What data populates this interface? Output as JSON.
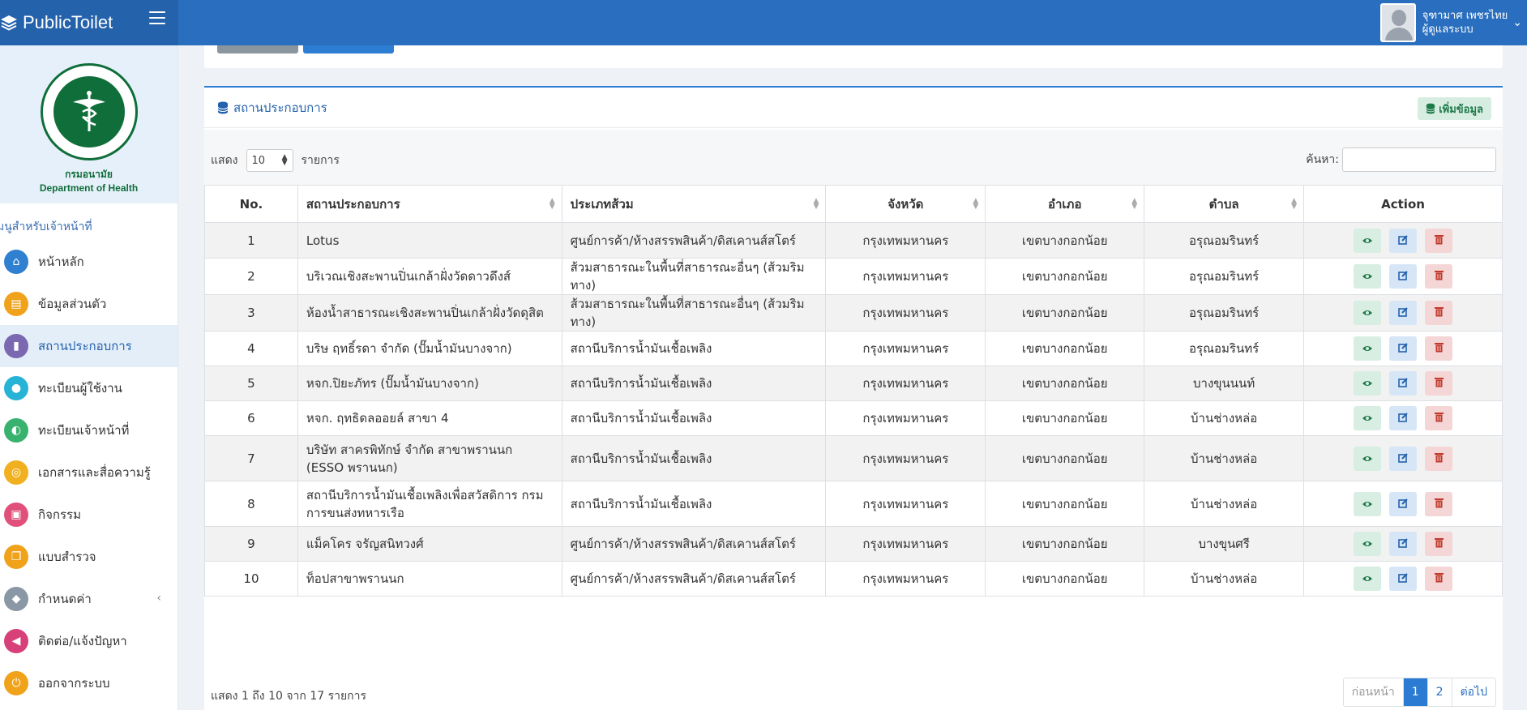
{
  "app": {
    "title": "PublicToilet"
  },
  "user": {
    "name": "จุฑามาศ เพชรไทย",
    "role": "ผู้ดูแลระบบ"
  },
  "sidebar": {
    "dept_line1": "กรมอนามัย",
    "dept_line2": "Department of Health",
    "heading": "มนูสำหรับเจ้าหน้าที่",
    "items": [
      {
        "label": "หน้าหลัก",
        "icon": "home-icon",
        "color": "#2f80d0"
      },
      {
        "label": "ข้อมูลส่วนตัว",
        "icon": "id-card-icon",
        "color": "#f0a21a"
      },
      {
        "label": "สถานประกอบการ",
        "icon": "building-icon",
        "color": "#7a68b0"
      },
      {
        "label": "ทะเบียนผู้ใช้งาน",
        "icon": "user-icon",
        "color": "#27b3d6"
      },
      {
        "label": "ทะเบียนเจ้าหน้าที่",
        "icon": "user-gear-icon",
        "color": "#38b26e"
      },
      {
        "label": "เอกสารและสื่อความรู้",
        "icon": "lightbulb-icon",
        "color": "#f0b020"
      },
      {
        "label": "กิจกรรม",
        "icon": "image-icon",
        "color": "#e0507a"
      },
      {
        "label": "แบบสำรวจ",
        "icon": "window-icon",
        "color": "#f0a21a"
      },
      {
        "label": "กำหนดค่า",
        "icon": "cube-icon",
        "color": "#8a97a4"
      },
      {
        "label": "ติดต่อ/แจ้งปัญหา",
        "icon": "megaphone-icon",
        "color": "#d8407a"
      },
      {
        "label": "ออกจากระบบ",
        "icon": "power-icon",
        "color": "#f0a21a"
      }
    ]
  },
  "panel": {
    "title": "สถานประกอบการ",
    "add_label": "เพิ่มข้อมูล",
    "show_label": "แสดง",
    "length_value": "10",
    "entries_label": "รายการ",
    "search_label": "ค้นหา:",
    "search_value": ""
  },
  "table": {
    "headers": [
      "No.",
      "สถานประกอบการ",
      "ประเภทส้วม",
      "จังหวัด",
      "อำเภอ",
      "ตำบล",
      "Action"
    ],
    "rows": [
      {
        "no": "1",
        "name": "Lotus",
        "type": "ศูนย์การค้า/ห้างสรรพสินค้า/ดิสเคานส์สโตร์",
        "province": "กรุงเทพมหานคร",
        "district": "เขตบางกอกน้อย",
        "subdistrict": "อรุณอมรินทร์"
      },
      {
        "no": "2",
        "name": "บริเวณเชิงสะพานปิ่นเกล้าฝั่งวัดดาวดึงส์",
        "type": "ส้วมสาธารณะในพื้นที่สาธารณะอื่นๆ (ส้วมริมทาง)",
        "province": "กรุงเทพมหานคร",
        "district": "เขตบางกอกน้อย",
        "subdistrict": "อรุณอมรินทร์"
      },
      {
        "no": "3",
        "name": "ห้องน้ำสาธารณะเชิงสะพานปิ่นเกล้าฝั่งวัดดุสิต",
        "type": "ส้วมสาธารณะในพื้นที่สาธารณะอื่นๆ (ส้วมริมทาง)",
        "province": "กรุงเทพมหานคร",
        "district": "เขตบางกอกน้อย",
        "subdistrict": "อรุณอมรินทร์"
      },
      {
        "no": "4",
        "name": "บริษ ฤทธิ์รดา จำกัด (ปั๊มน้ำมันบางจาก)",
        "type": "สถานีบริการน้ำมันเชื้อเพลิง",
        "province": "กรุงเทพมหานคร",
        "district": "เขตบางกอกน้อย",
        "subdistrict": "อรุณอมรินทร์"
      },
      {
        "no": "5",
        "name": "หจก.ปิยะภัทร (ปั๊มน้ำมันบางจาก)",
        "type": "สถานีบริการน้ำมันเชื้อเพลิง",
        "province": "กรุงเทพมหานคร",
        "district": "เขตบางกอกน้อย",
        "subdistrict": "บางขุนนนท์"
      },
      {
        "no": "6",
        "name": "หจก. ฤทธิดลออยล์ สาขา 4",
        "type": "สถานีบริการน้ำมันเชื้อเพลิง",
        "province": "กรุงเทพมหานคร",
        "district": "เขตบางกอกน้อย",
        "subdistrict": "บ้านช่างหล่อ"
      },
      {
        "no": "7",
        "name": "บริษัท สาครพิทักษ์ จำกัด สาขาพรานนก (ESSO พรานนก)",
        "type": "สถานีบริการน้ำมันเชื้อเพลิง",
        "province": "กรุงเทพมหานคร",
        "district": "เขตบางกอกน้อย",
        "subdistrict": "บ้านช่างหล่อ"
      },
      {
        "no": "8",
        "name": "สถานีบริการน้ำมันเชื้อเพลิงเพื่อสวัสดิการ กรมการขนส่งทหารเรือ",
        "type": "สถานีบริการน้ำมันเชื้อเพลิง",
        "province": "กรุงเทพมหานคร",
        "district": "เขตบางกอกน้อย",
        "subdistrict": "บ้านช่างหล่อ"
      },
      {
        "no": "9",
        "name": "แม็คโคร จรัญสนิทวงศ์",
        "type": "ศูนย์การค้า/ห้างสรรพสินค้า/ดิสเคานส์สโตร์",
        "province": "กรุงเทพมหานคร",
        "district": "เขตบางกอกน้อย",
        "subdistrict": "บางขุนศรี"
      },
      {
        "no": "10",
        "name": "ท็อปสาขาพรานนก",
        "type": "ศูนย์การค้า/ห้างสรรพสินค้า/ดิสเคานส์สโตร์",
        "province": "กรุงเทพมหานคร",
        "district": "เขตบางกอกน้อย",
        "subdistrict": "บ้านช่างหล่อ"
      }
    ]
  },
  "footer": {
    "info": "แสดง 1 ถึง 10 จาก 17 รายการ",
    "prev": "ก่อนหน้า",
    "pages": [
      "1",
      "2"
    ],
    "active_page": "1",
    "next": "ต่อไป"
  }
}
